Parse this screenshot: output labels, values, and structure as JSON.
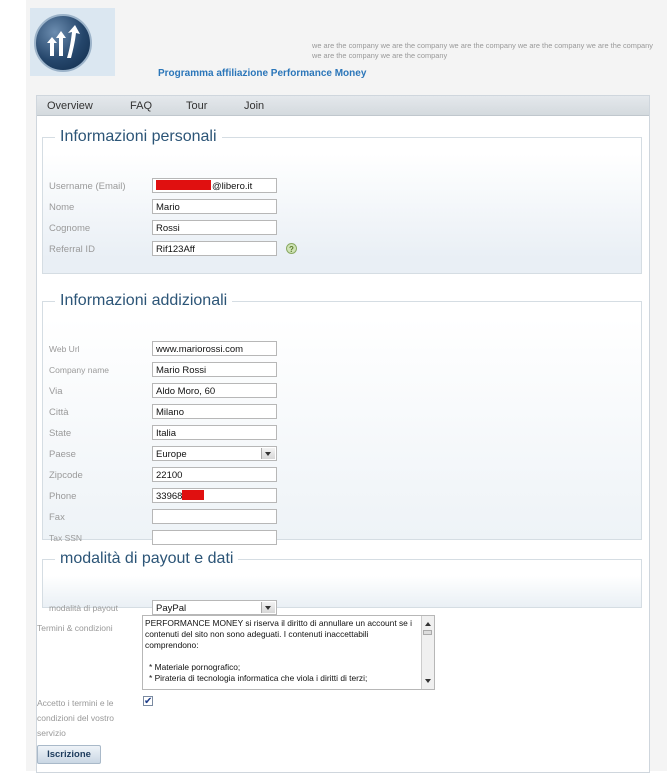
{
  "header": {
    "tagline": "we are the company we are the company we are the company we are the company we are the company we are the company we are the company",
    "program_title": "Programma affiliazione Performance Money",
    "logo_icon": "upward-arrows-logo"
  },
  "nav": {
    "items": [
      "Overview",
      "FAQ",
      "Tour",
      "Join"
    ]
  },
  "personal": {
    "legend": "Informazioni personali",
    "username_label": "Username (Email)",
    "username_value": "@libero.it",
    "name_label": "Nome",
    "name_value": "Mario",
    "surname_label": "Cognome",
    "surname_value": "Rossi",
    "referral_label": "Referral ID",
    "referral_value": "Rif123Aff",
    "help_glyph": "?"
  },
  "additional": {
    "legend": "Informazioni addizionali",
    "web_label": "Web Url",
    "web_value": "www.mariorossi.com",
    "company_label": "Company name",
    "company_value": "Mario Rossi",
    "street_label": "Via",
    "street_value": "Aldo Moro, 60",
    "city_label": "Città",
    "city_value": "Milano",
    "state_label": "State",
    "state_value": "Italia",
    "country_label": "Paese",
    "country_value": "Europe",
    "zip_label": "Zipcode",
    "zip_value": "22100",
    "phone_label": "Phone",
    "phone_value": "33968",
    "fax_label": "Fax",
    "fax_value": "",
    "tax_label": "Tax SSN",
    "tax_value": ""
  },
  "payout": {
    "legend": "modalità di payout e dati",
    "method_label": "modalità di payout",
    "method_value": "PayPal"
  },
  "terms": {
    "label": "Termini & condizioni",
    "text_p1": "PERFORMANCE MONEY si riserva il diritto di annullare un account se i contenuti del sito non sono adeguati. I contenuti inaccettabili comprendono:",
    "text_li1": "* Materiale pornografico;",
    "text_li2": "* Pirateria di tecnologia informatica che viola i diritti di terzi;",
    "accept_label": "Accetto i termini e le condizioni del vostro servizio",
    "check_glyph": "✔",
    "accepted": true,
    "submit_label": "Iscrizione"
  }
}
